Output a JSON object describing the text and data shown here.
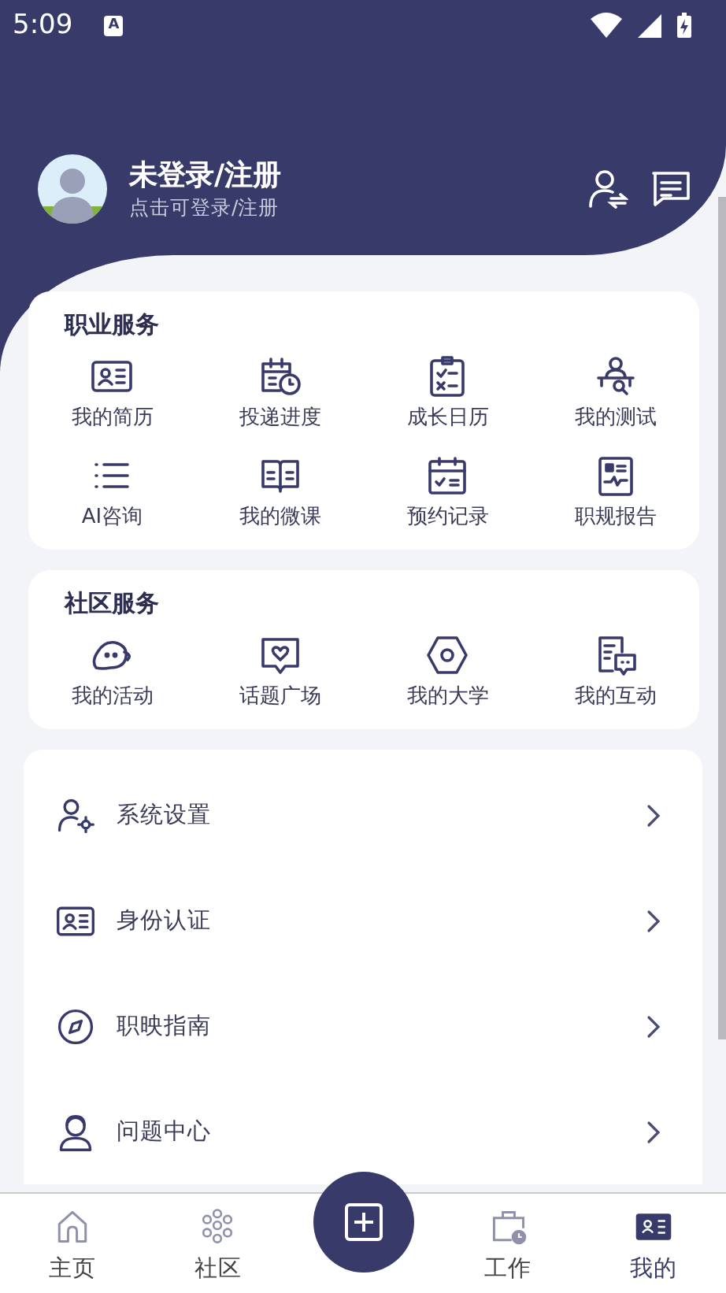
{
  "status_bar": {
    "time": "5:09",
    "notification": "A"
  },
  "profile": {
    "name": "未登录/注册",
    "subtitle": "点击可登录/注册"
  },
  "career_services": {
    "title": "职业服务",
    "items": [
      {
        "label": "我的简历"
      },
      {
        "label": "投递进度"
      },
      {
        "label": "成长日历"
      },
      {
        "label": "我的测试"
      },
      {
        "label": "AI咨询"
      },
      {
        "label": "我的微课"
      },
      {
        "label": "预约记录"
      },
      {
        "label": "职规报告"
      }
    ]
  },
  "community_services": {
    "title": "社区服务",
    "items": [
      {
        "label": "我的活动"
      },
      {
        "label": "话题广场"
      },
      {
        "label": "我的大学"
      },
      {
        "label": "我的互动"
      }
    ]
  },
  "menu": [
    {
      "label": "系统设置"
    },
    {
      "label": "身份认证"
    },
    {
      "label": "职映指南"
    },
    {
      "label": "问题中心"
    }
  ],
  "bottom_nav": [
    {
      "label": "主页",
      "selected": false
    },
    {
      "label": "社区",
      "selected": false
    },
    {
      "label": "工作",
      "selected": false
    },
    {
      "label": "我的",
      "selected": true
    }
  ]
}
